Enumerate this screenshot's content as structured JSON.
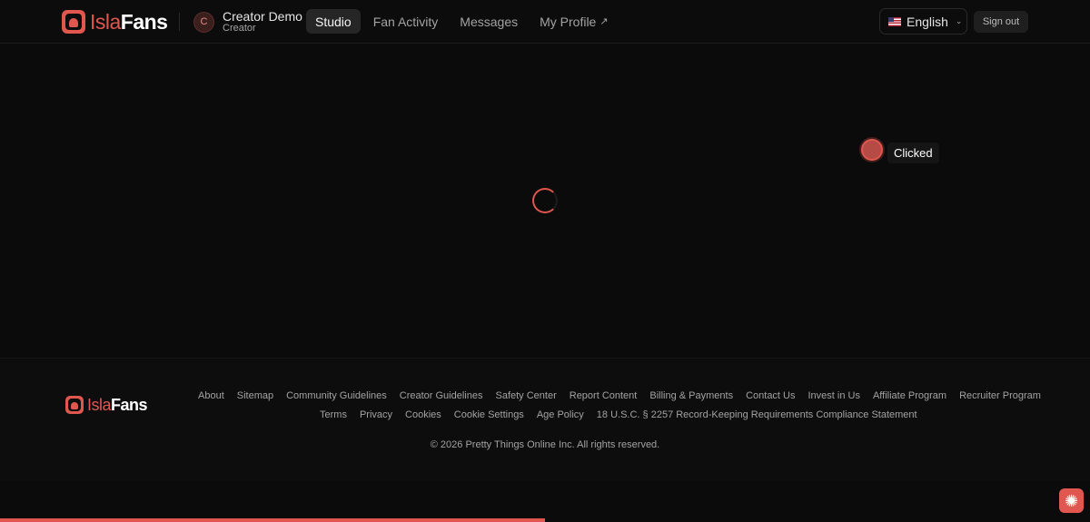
{
  "header": {
    "logo_a": "Isla",
    "logo_b": "Fans",
    "user": {
      "initial": "C",
      "name": "Creator Demo",
      "role": "Creator"
    },
    "nav": [
      {
        "label": "Studio",
        "active": true
      },
      {
        "label": "Fan Activity",
        "active": false
      },
      {
        "label": "Messages",
        "active": false
      },
      {
        "label": "My Profile",
        "active": false,
        "external_icon": "↗"
      }
    ],
    "language": {
      "label": "English",
      "flag_icon": "us-flag-icon",
      "chevron_icon": "chevron-down-icon"
    },
    "sign_out_label": "Sign out"
  },
  "main": {
    "loading_icon": "spinner-icon",
    "click_marker": {
      "label": "Clicked"
    }
  },
  "footer": {
    "logo_a": "Isla",
    "logo_b": "Fans",
    "links_row1": [
      "About",
      "Sitemap",
      "Community Guidelines",
      "Creator Guidelines",
      "Safety Center",
      "Report Content",
      "Billing & Payments",
      "Contact Us",
      "Invest in Us",
      "Affiliate Program",
      "Recruiter Program"
    ],
    "links_row2": [
      "Terms",
      "Privacy",
      "Cookies",
      "Cookie Settings",
      "Age Policy",
      "18 U.S.C. § 2257 Record-Keeping Requirements Compliance Statement"
    ],
    "copyright": "© 2026 Pretty Things Online Inc. All rights reserved."
  },
  "progress": {
    "fraction": 0.5
  },
  "assistant_button": {
    "icon": "sparkle-icon"
  },
  "colors": {
    "accent": "#e0574f",
    "background": "#0b0b0b"
  }
}
